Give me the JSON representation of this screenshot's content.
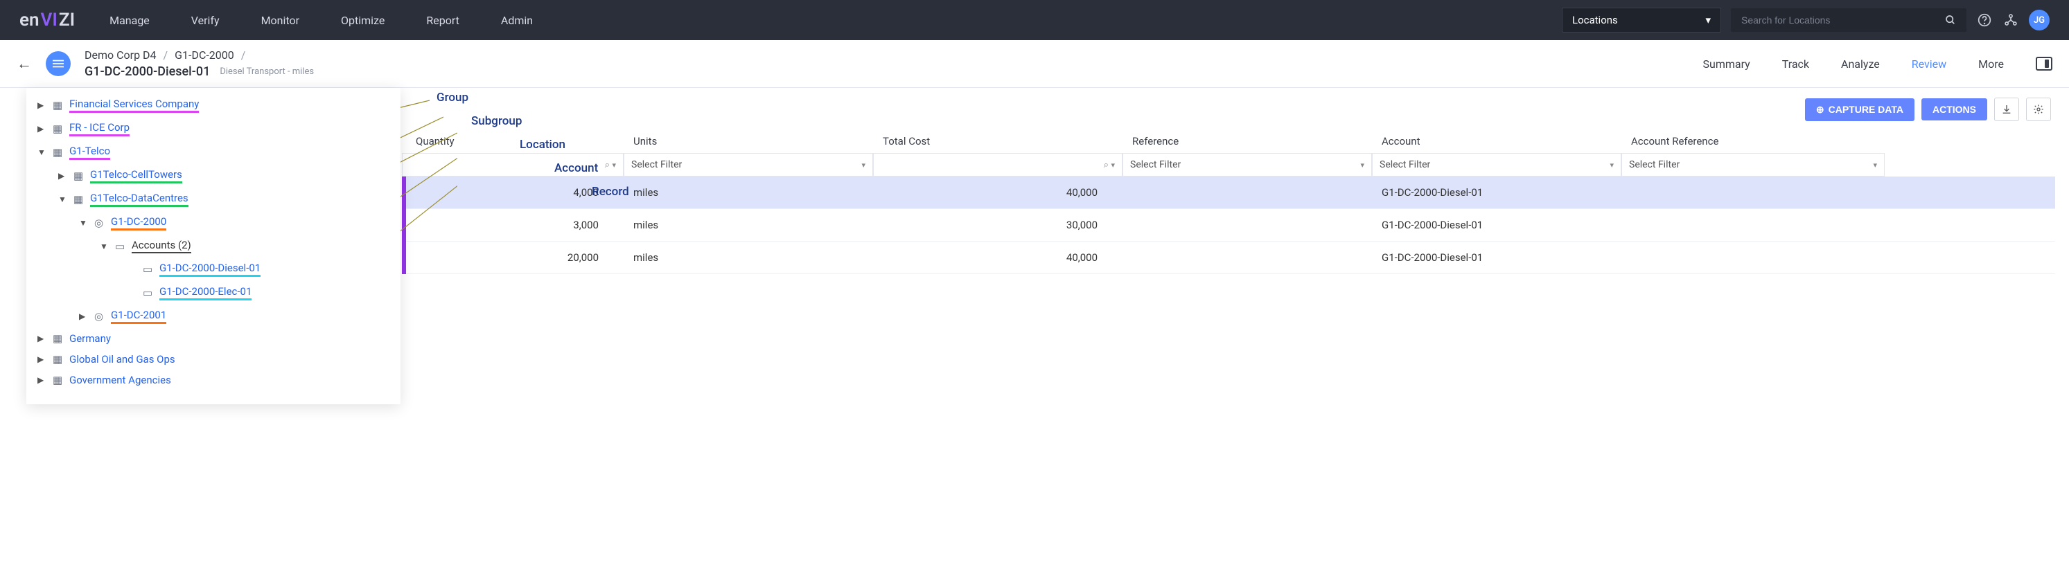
{
  "logo": {
    "prefix": "en",
    "accent": "VI",
    "suffix": "ZI"
  },
  "nav": {
    "items": [
      "Manage",
      "Verify",
      "Monitor",
      "Optimize",
      "Report",
      "Admin"
    ]
  },
  "search": {
    "scope": "Locations",
    "placeholder": "Search for Locations"
  },
  "user": {
    "initials": "JG"
  },
  "breadcrumb": {
    "level1": "Demo Corp D4",
    "level2": "G1-DC-2000",
    "level3": "G1-DC-2000-Diesel-01",
    "subtitle": "Diesel Transport - miles"
  },
  "tabs": {
    "items": [
      "Summary",
      "Track",
      "Analyze",
      "Review",
      "More"
    ],
    "active": "Review"
  },
  "annotations": {
    "group": "Group",
    "subgroup": "Subgroup",
    "location": "Location",
    "account": "Account",
    "record": "Record"
  },
  "tree": {
    "financial": "Financial Services Company",
    "fr_ice": "FR - ICE Corp",
    "g1telco": "G1-Telco",
    "celltowers": "G1Telco-CellTowers",
    "datacentres": "G1Telco-DataCentres",
    "dc2000": "G1-DC-2000",
    "accounts": "Accounts (2)",
    "diesel01": "G1-DC-2000-Diesel-01",
    "elec01": "G1-DC-2000-Elec-01",
    "dc2001": "G1-DC-2001",
    "germany": "Germany",
    "globaloil": "Global Oil and Gas Ops",
    "govt": "Government Agencies"
  },
  "actions": {
    "capture": "CAPTURE DATA",
    "actions": "ACTIONS"
  },
  "table": {
    "columns": {
      "quantity": "Quantity",
      "units": "Units",
      "total_cost": "Total Cost",
      "reference": "Reference",
      "account": "Account",
      "account_reference": "Account Reference"
    },
    "filter_label": "Select Filter",
    "rows": [
      {
        "quantity": "4,000",
        "units": "miles",
        "total_cost": "40,000",
        "reference": "",
        "account": "G1-DC-2000-Diesel-01",
        "account_reference": "",
        "selected": true
      },
      {
        "quantity": "3,000",
        "units": "miles",
        "total_cost": "30,000",
        "reference": "",
        "account": "G1-DC-2000-Diesel-01",
        "account_reference": "",
        "selected": false
      },
      {
        "quantity": "20,000",
        "units": "miles",
        "total_cost": "40,000",
        "reference": "",
        "account": "G1-DC-2000-Diesel-01",
        "account_reference": "",
        "selected": false
      }
    ]
  }
}
